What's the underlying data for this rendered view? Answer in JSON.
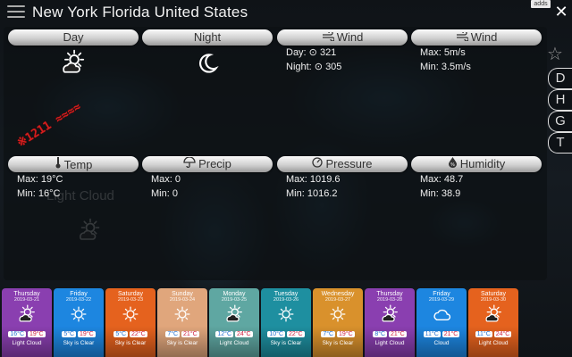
{
  "header": {
    "title": "New York Florida United States",
    "adds_label": "adds",
    "close_label": "✕"
  },
  "cards": [
    {
      "key": "day",
      "label": "Day",
      "icon": "sun-cloud-icon",
      "lines": []
    },
    {
      "key": "night",
      "label": "Night",
      "icon": "moon-icon",
      "lines": []
    },
    {
      "key": "wind-dir",
      "label": "Wind",
      "icon": "wind-icon",
      "lines": [
        "Day: ⊙ 321",
        "Night: ⊙ 305"
      ]
    },
    {
      "key": "wind-speed",
      "label": "Wind",
      "icon": "wind-icon",
      "lines": [
        "Max: 5m/s",
        "Min: 3.5m/s"
      ]
    },
    {
      "key": "temp",
      "label": "Temp",
      "icon": "thermometer-icon",
      "lines": [
        "Max: 19°C",
        "Min: 16°C"
      ]
    },
    {
      "key": "precip",
      "label": "Precip",
      "icon": "umbrella-icon",
      "lines": [
        "Max: 0",
        "Min: 0"
      ]
    },
    {
      "key": "pressure",
      "label": "Pressure",
      "icon": "gauge-icon",
      "lines": [
        "Max: 1019.6",
        "Min: 1016.2"
      ]
    },
    {
      "key": "humidity",
      "label": "Humidity",
      "icon": "drop-percent-icon",
      "lines": [
        "Max: 48.7",
        "Min: 38.9"
      ]
    }
  ],
  "stamp_text": "※1211 ≈≈≈≈",
  "ghost": {
    "label": "Light Cloud"
  },
  "side_buttons": [
    "D",
    "H",
    "G",
    "T"
  ],
  "forecast": [
    {
      "day": "Thursday",
      "date": "2019-03-21",
      "lo": "16°C",
      "hi": "19°C",
      "cond": "Light Cloud",
      "color": "#8a3fb0",
      "icon": "sun-cloud-icon"
    },
    {
      "day": "Friday",
      "date": "2019-03-22",
      "lo": "5°C",
      "hi": "19°C",
      "cond": "Sky is Clear",
      "color": "#1d86e0",
      "icon": "sun-icon"
    },
    {
      "day": "Saturday",
      "date": "2019-03-23",
      "lo": "5°C",
      "hi": "22°C",
      "cond": "Sky is Clear",
      "color": "#e5621e",
      "icon": "sun-icon"
    },
    {
      "day": "Sunday",
      "date": "2019-03-24",
      "lo": "7°C",
      "hi": "21°C",
      "cond": "Sky is Clear",
      "color": "#e0a67c",
      "icon": "sun-icon"
    },
    {
      "day": "Monday",
      "date": "2019-03-25",
      "lo": "12°C",
      "hi": "24°C",
      "cond": "Light Cloud",
      "color": "#5fa7a2",
      "icon": "sun-cloud-icon"
    },
    {
      "day": "Tuesday",
      "date": "2019-03-26",
      "lo": "10°C",
      "hi": "22°C",
      "cond": "Sky is Clear",
      "color": "#1e8fa0",
      "icon": "sun-icon"
    },
    {
      "day": "Wednesday",
      "date": "2019-03-27",
      "lo": "7°C",
      "hi": "19°C",
      "cond": "Sky is Clear",
      "color": "#d9912c",
      "icon": "sun-icon"
    },
    {
      "day": "Thursday",
      "date": "2019-03-28",
      "lo": "8°C",
      "hi": "21°C",
      "cond": "Light Cloud",
      "color": "#8a3fb0",
      "icon": "sun-cloud-icon"
    },
    {
      "day": "Friday",
      "date": "2019-03-29",
      "lo": "11°C",
      "hi": "21°C",
      "cond": "Cloud",
      "color": "#1d86e0",
      "icon": "cloud-icon"
    },
    {
      "day": "Saturday",
      "date": "2019-03-30",
      "lo": "11°C",
      "hi": "24°C",
      "cond": "Light Cloud",
      "color": "#e5621e",
      "icon": "sun-cloud-icon"
    }
  ]
}
